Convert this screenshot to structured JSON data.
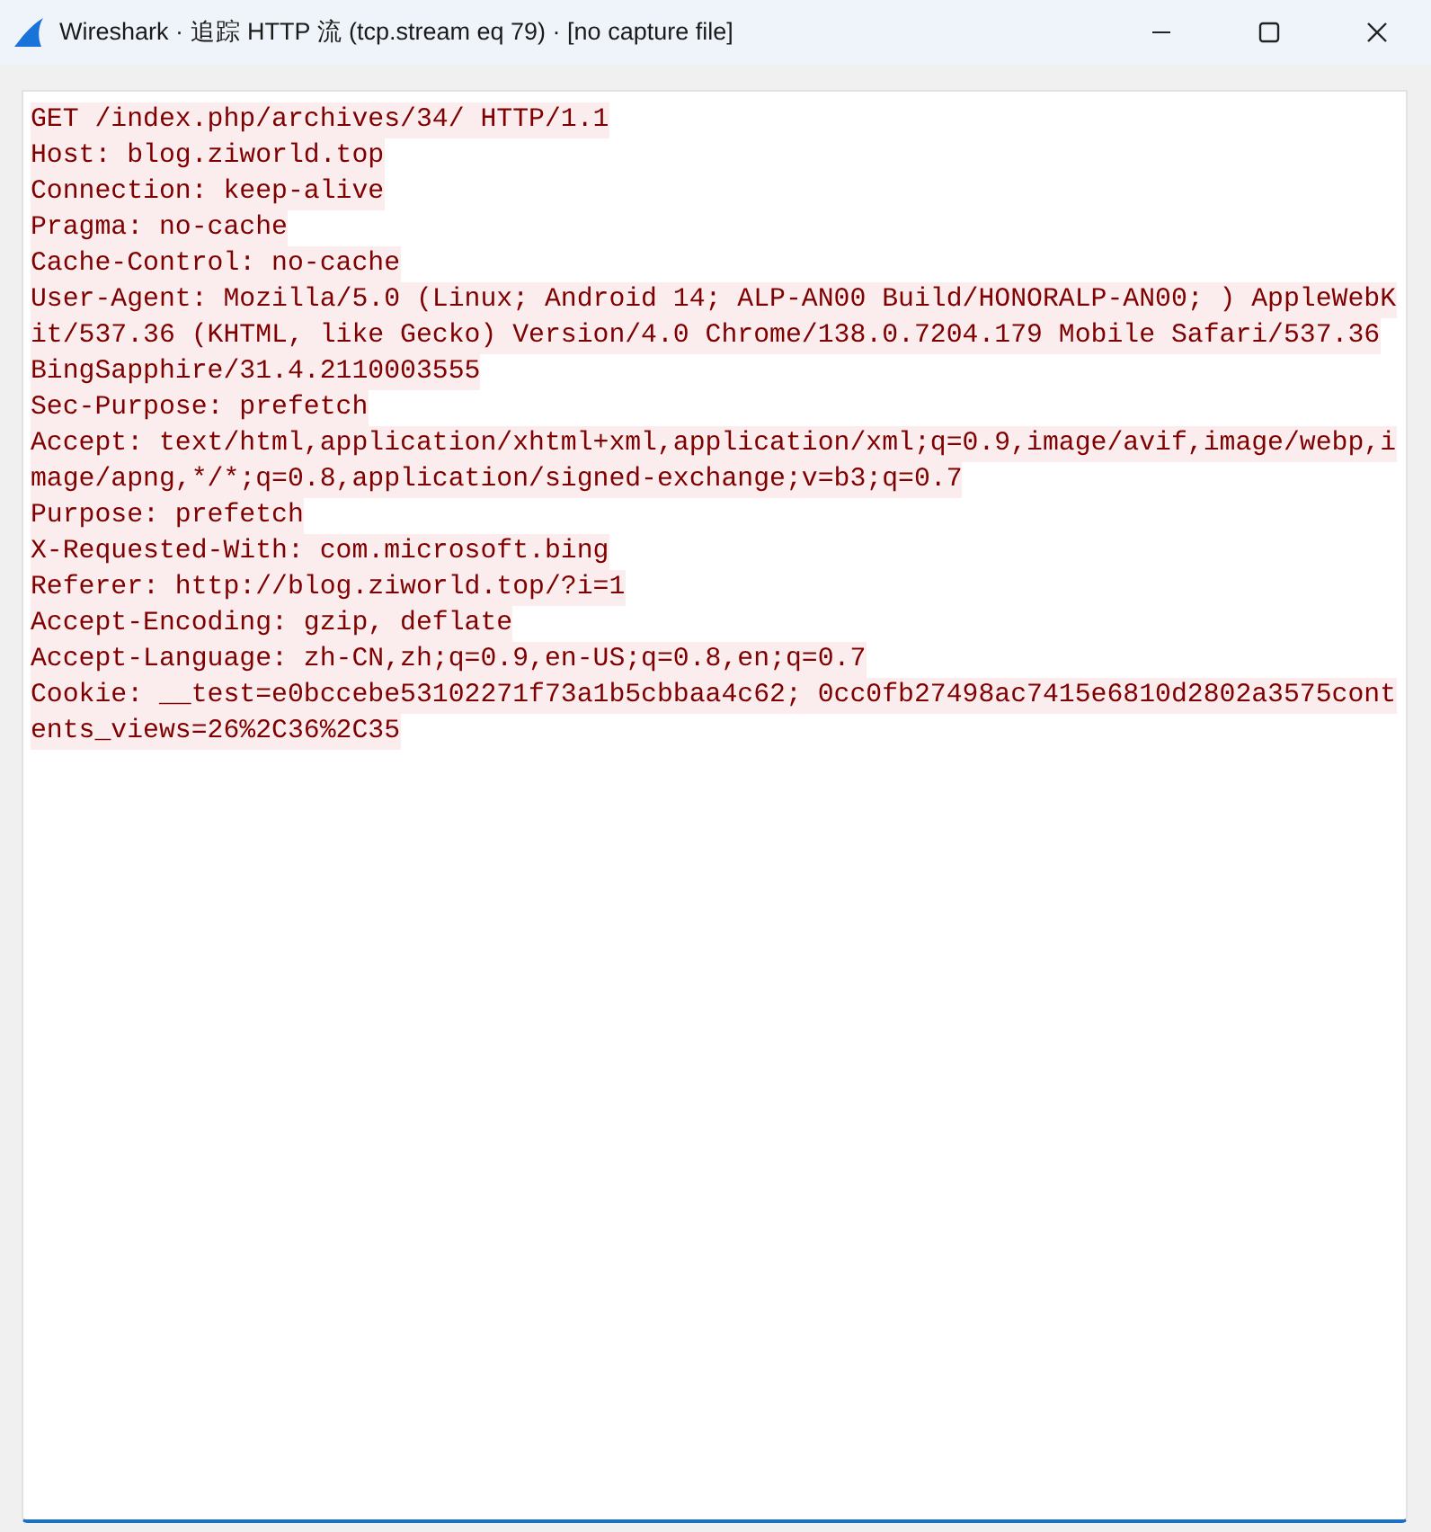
{
  "window": {
    "title": "Wireshark · 追踪 HTTP 流 (tcp.stream eq 79) · [no capture file]"
  },
  "stream": {
    "lines": [
      "GET /index.php/archives/34/ HTTP/1.1",
      "Host: blog.ziworld.top",
      "Connection: keep-alive",
      "Pragma: no-cache",
      "Cache-Control: no-cache",
      "User-Agent: Mozilla/5.0 (Linux; Android 14; ALP-AN00 Build/HONORALP-AN00; ) AppleWebK",
      "it/537.36 (KHTML, like Gecko) Version/4.0 Chrome/138.0.7204.179 Mobile Safari/537.36",
      "BingSapphire/31.4.2110003555",
      "Sec-Purpose: prefetch",
      "Accept: text/html,application/xhtml+xml,application/xml;q=0.9,image/avif,image/webp,i",
      "mage/apng,*/*;q=0.8,application/signed-exchange;v=b3;q=0.7",
      "Purpose: prefetch",
      "X-Requested-With: com.microsoft.bing",
      "Referer: http://blog.ziworld.top/?i=1",
      "Accept-Encoding: gzip, deflate",
      "Accept-Language: zh-CN,zh;q=0.9,en-US;q=0.8,en;q=0.7",
      "Cookie: __test=e0bccebe53102271f73a1b5cbbaa4c62; 0cc0fb27498ac7415e6810d2802a3575cont",
      "ents_views=26%2C36%2C35"
    ]
  }
}
